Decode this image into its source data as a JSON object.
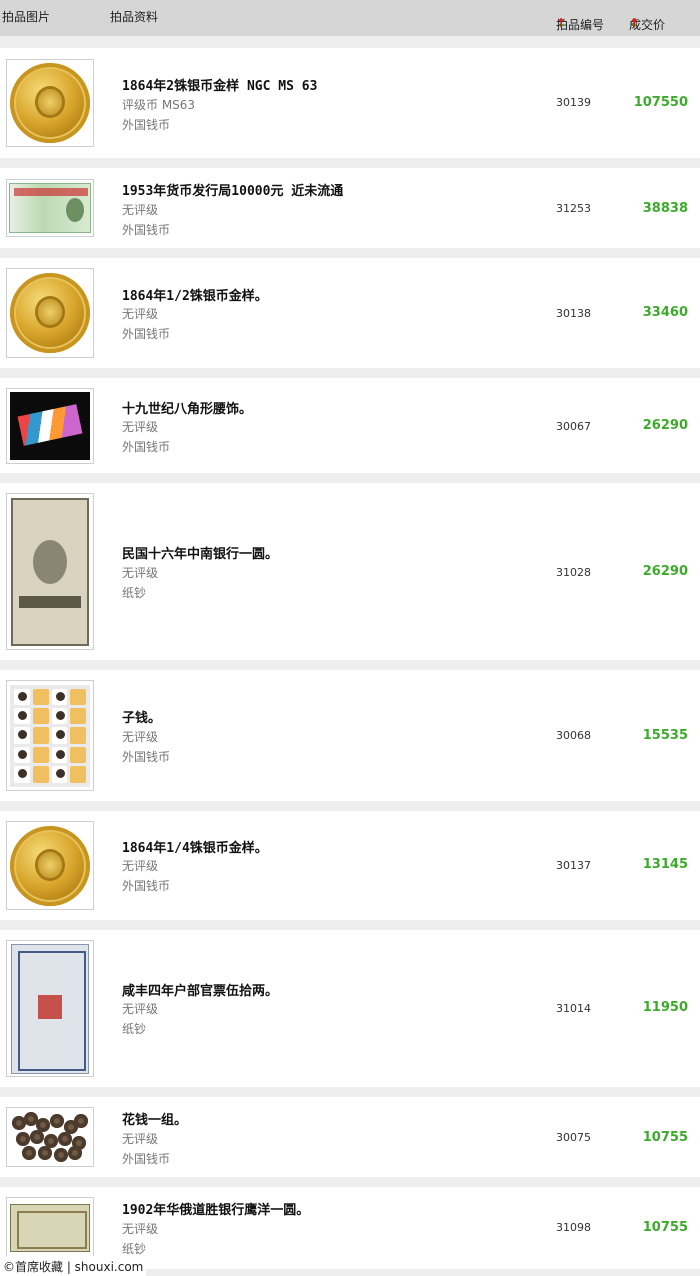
{
  "header": {
    "col_image": "拍品图片",
    "col_info": "拍品资料",
    "col_lot": "拍品编号",
    "col_price": "成交价",
    "sort_down_icon": "↓",
    "sort_up_icon": "↑"
  },
  "lots": [
    {
      "title": "1864年2铢银币金样 NGC MS 63",
      "grade": "评级币 MS63",
      "category": "外国钱币",
      "lot": "30139",
      "price": "107550",
      "thumb": "gold-coin-icon"
    },
    {
      "title": "1953年货币发行局10000元 近未流通",
      "grade": "无评级",
      "category": "外国钱币",
      "lot": "31253",
      "price": "38838",
      "thumb": "banknote-icon"
    },
    {
      "title": "1864年1/2铢银币金样。",
      "grade": "无评级",
      "category": "外国钱币",
      "lot": "30138",
      "price": "33460",
      "thumb": "gold-coin-icon"
    },
    {
      "title": "十九世纪八角形腰饰。",
      "grade": "无评级",
      "category": "外国钱币",
      "lot": "30067",
      "price": "26290",
      "thumb": "ornament-icon"
    },
    {
      "title": "民国十六年中南银行一圆。",
      "grade": "无评级",
      "category": "纸钞",
      "lot": "31028",
      "price": "26290",
      "thumb": "banknote-icon"
    },
    {
      "title": "子钱。",
      "grade": "无评级",
      "category": "外国钱币",
      "lot": "30068",
      "price": "15535",
      "thumb": "coin-tray-icon"
    },
    {
      "title": "1864年1/4铢银币金样。",
      "grade": "无评级",
      "category": "外国钱币",
      "lot": "30137",
      "price": "13145",
      "thumb": "gold-coin-icon"
    },
    {
      "title": "咸丰四年户部官票伍拾两。",
      "grade": "无评级",
      "category": "纸钞",
      "lot": "31014",
      "price": "11950",
      "thumb": "banknote-icon"
    },
    {
      "title": "花钱一组。",
      "grade": "无评级",
      "category": "外国钱币",
      "lot": "30075",
      "price": "10755",
      "thumb": "cash-coins-icon"
    },
    {
      "title": "1902年华俄道胜银行鹰洋一圆。",
      "grade": "无评级",
      "category": "纸钞",
      "lot": "31098",
      "price": "10755",
      "thumb": "banknote-icon"
    }
  ],
  "watermark": "©首席收藏 | shouxi.com"
}
